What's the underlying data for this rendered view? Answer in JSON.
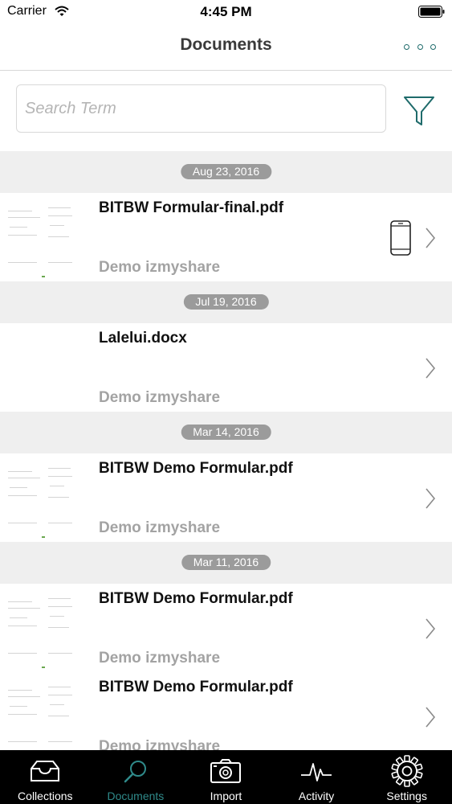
{
  "status_bar": {
    "carrier": "Carrier",
    "time": "4:45 PM"
  },
  "nav": {
    "title": "Documents",
    "more_icon": "more-dots-icon"
  },
  "search": {
    "placeholder": "Search Term",
    "value": "",
    "filter_icon": "filter-funnel-icon"
  },
  "sections": [
    {
      "date": "Aug 23, 2016",
      "items": [
        {
          "title": "BITBW Formular-final.pdf",
          "owner": "Demo izmyshare",
          "on_device": true
        }
      ]
    },
    {
      "date": "Jul 19, 2016",
      "items": [
        {
          "title": "Lalelui.docx",
          "owner": "Demo izmyshare",
          "on_device": false
        }
      ]
    },
    {
      "date": "Mar 14, 2016",
      "items": [
        {
          "title": "BITBW Demo Formular.pdf",
          "owner": "Demo izmyshare",
          "on_device": false
        }
      ]
    },
    {
      "date": "Mar 11, 2016",
      "items": [
        {
          "title": "BITBW Demo Formular.pdf",
          "owner": "Demo izmyshare",
          "on_device": false
        },
        {
          "title": "BITBW Demo Formular.pdf",
          "owner": "Demo izmyshare",
          "on_device": false
        }
      ]
    }
  ],
  "tabs": [
    {
      "label": "Collections",
      "icon": "inbox-tray-icon",
      "active": false
    },
    {
      "label": "Documents",
      "icon": "search-icon",
      "active": true
    },
    {
      "label": "Import",
      "icon": "camera-icon",
      "active": false
    },
    {
      "label": "Activity",
      "icon": "activity-pulse-icon",
      "active": false
    },
    {
      "label": "Settings",
      "icon": "gear-icon",
      "active": false
    }
  ],
  "colors": {
    "accent": "#2f8a8a",
    "pill": "#9b9b9b",
    "section_bg": "#efefef",
    "tab_bar": "#000000"
  }
}
